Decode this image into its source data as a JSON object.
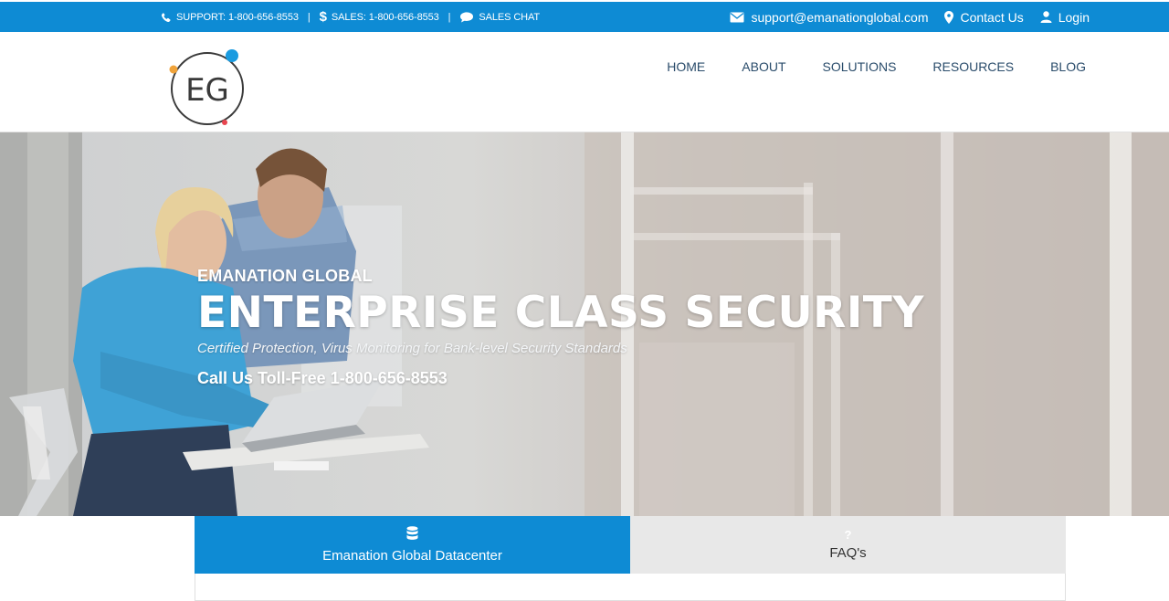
{
  "topbar": {
    "support": "SUPPORT: 1-800-656-8553",
    "separator": "|",
    "sales": "SALES: 1-800-656-8553",
    "chat": "SALES CHAT",
    "email": "support@emanationglobal.com",
    "contact": "Contact Us",
    "login": "Login"
  },
  "logo": {
    "text": "EG"
  },
  "nav": {
    "items": [
      {
        "label": "HOME"
      },
      {
        "label": "ABOUT"
      },
      {
        "label": "SOLUTIONS"
      },
      {
        "label": "RESOURCES"
      },
      {
        "label": "BLOG"
      }
    ]
  },
  "hero": {
    "eyebrow": "EMANATION GLOBAL",
    "headline": "ENTERPRISE CLASS SECURITY",
    "subline": "Certified Protection, Virus Monitoring for Bank-level Security Standards",
    "cta": "Call Us Toll-Free 1-800-656-8553"
  },
  "tabs": [
    {
      "label": "Emanation Global Datacenter",
      "icon": "database-icon",
      "active": true
    },
    {
      "label": "FAQ's",
      "icon": "question-icon",
      "active": false
    }
  ],
  "colors": {
    "accent": "#0e8bd4",
    "nav_text": "#2a4c6b",
    "logo_blue": "#1a9be0",
    "logo_orange": "#f0a33a",
    "logo_red": "#e8454f"
  }
}
